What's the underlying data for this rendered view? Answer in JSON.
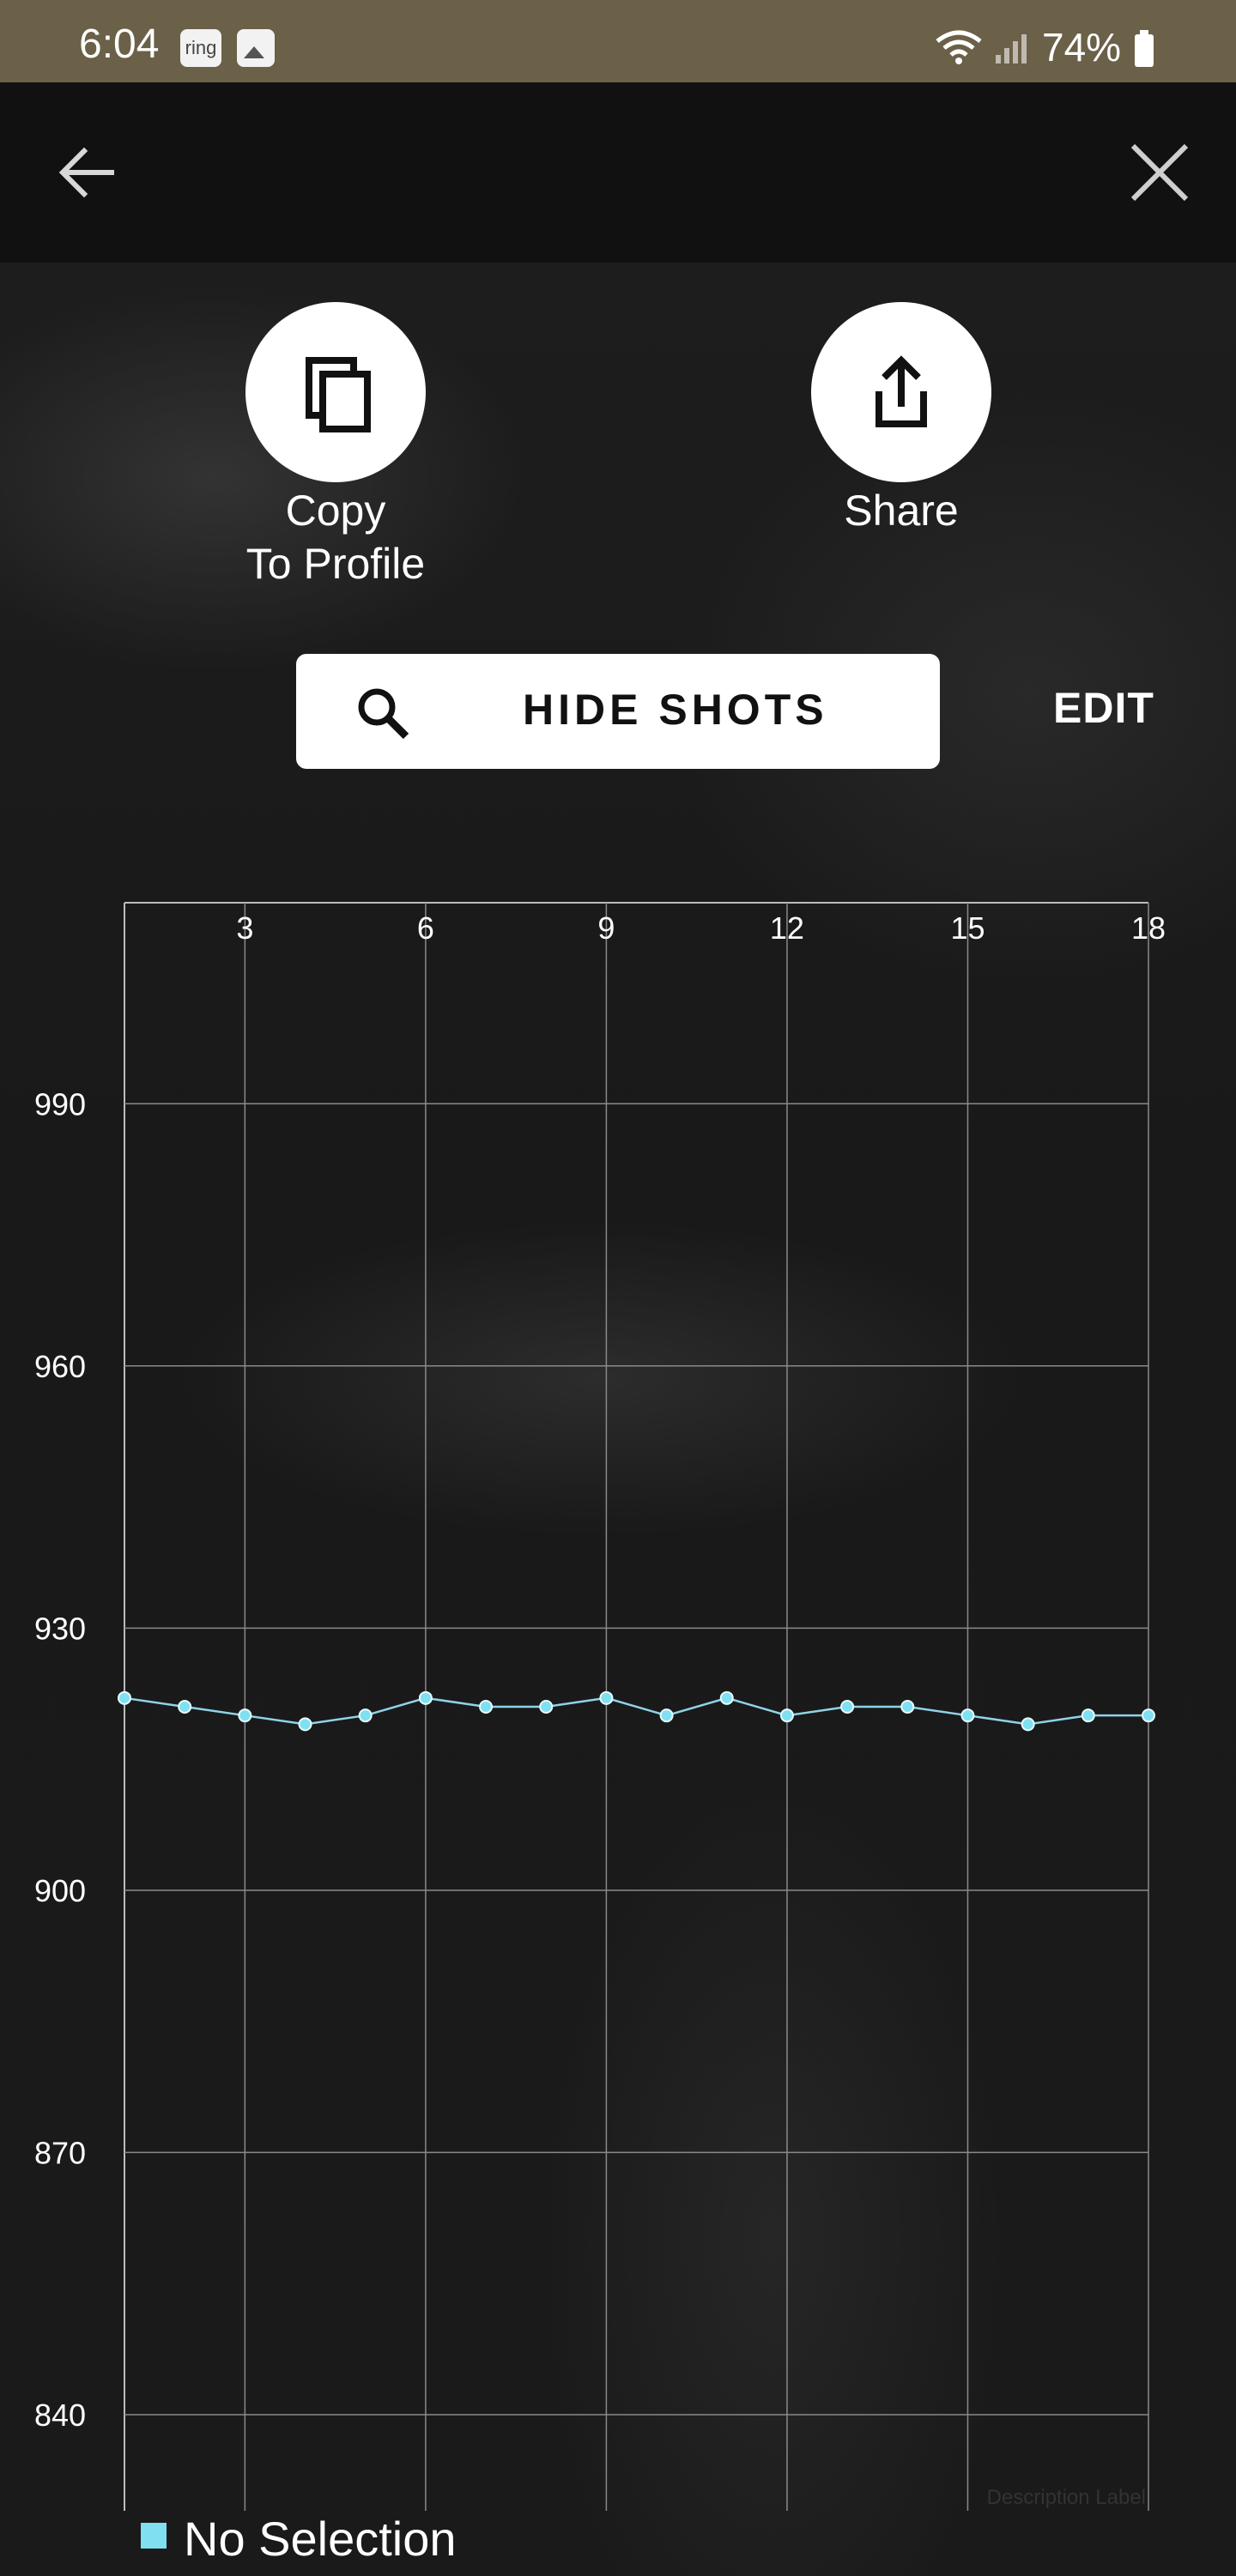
{
  "status_bar": {
    "time": "6:04",
    "ring_icon_text": "ring",
    "battery": "74%",
    "icons": [
      "ring-app-icon",
      "gallery-icon",
      "wifi-icon",
      "signal-icon",
      "battery-icon"
    ]
  },
  "app_bar": {
    "icons": [
      "arrow-left-icon",
      "close-icon"
    ]
  },
  "actions": {
    "copy_line1": "Copy",
    "copy_line2": "To Profile",
    "share": "Share",
    "copy_icon": "copy-icon",
    "share_icon": "share-icon"
  },
  "toolbar": {
    "hide_shots": "HIDE SHOTS",
    "edit": "EDIT",
    "search_icon": "search-icon"
  },
  "chart_data": {
    "type": "line",
    "x": [
      1,
      2,
      3,
      4,
      5,
      6,
      7,
      8,
      9,
      10,
      11,
      12,
      13,
      14,
      15,
      16,
      17,
      18
    ],
    "series": [
      {
        "values": [
          922,
          921,
          920,
          919,
          920,
          922,
          921,
          921,
          922,
          920,
          922,
          920,
          921,
          921,
          920,
          919,
          920,
          920
        ]
      }
    ],
    "x_ticks": [
      3,
      6,
      9,
      12,
      15,
      18
    ],
    "y_ticks": [
      840,
      870,
      900,
      930,
      960,
      990
    ],
    "xlim": [
      1,
      18
    ],
    "ylim": [
      829,
      1013
    ],
    "x_axis_position": "top",
    "grid": true,
    "description_label": "Description Label",
    "line_color": "#8fd3e8",
    "legend": {
      "label": "No Selection",
      "color": "#7fe0f2",
      "position": "bottom-left"
    }
  }
}
